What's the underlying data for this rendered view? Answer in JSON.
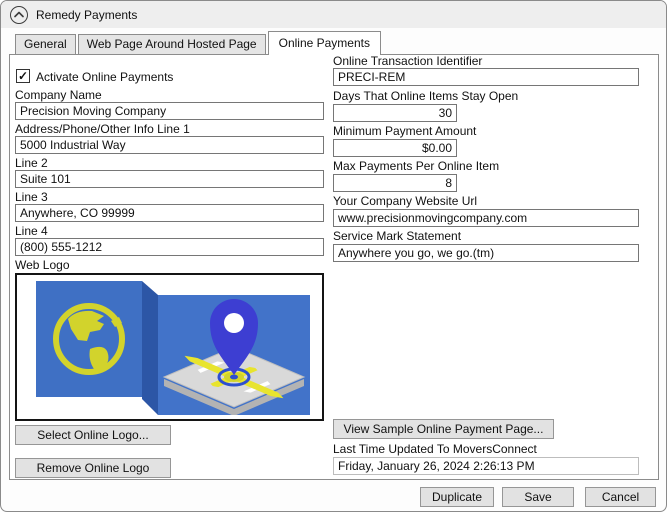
{
  "dialog": {
    "title": "Remedy Payments"
  },
  "tabs": [
    {
      "label": "General"
    },
    {
      "label": "Web Page Around Hosted Page"
    },
    {
      "label": "Online Payments"
    }
  ],
  "activate": {
    "label": "Activate Online Payments",
    "checked": true,
    "check_glyph": "✓"
  },
  "left": {
    "company_name": {
      "label": "Company Name",
      "value": "Precision Moving Company"
    },
    "address1": {
      "label": "Address/Phone/Other Info Line 1",
      "value": "5000 Industrial Way"
    },
    "line2": {
      "label": "Line 2",
      "value": "Suite 101"
    },
    "line3": {
      "label": "Line 3",
      "value": "Anywhere, CO 99999"
    },
    "line4": {
      "label": "Line 4",
      "value": "(800) 555-1212"
    },
    "web_logo_label": "Web Logo",
    "select_logo_button": "Select Online Logo...",
    "remove_logo_button": "Remove Online Logo"
  },
  "right": {
    "transaction_id": {
      "label": "Online Transaction Identifier",
      "value": "PRECI-REM"
    },
    "days_open": {
      "label": "Days That Online Items Stay Open",
      "value": "30"
    },
    "min_payment": {
      "label": "Minimum Payment Amount",
      "value": "$0.00"
    },
    "max_payments": {
      "label": "Max Payments Per Online Item",
      "value": "8"
    },
    "website_url": {
      "label": "Your Company Website Url",
      "value": "www.precisionmovingcompany.com"
    },
    "service_mark": {
      "label": "Service Mark Statement",
      "value": "Anywhere you go, we go.(tm)"
    },
    "view_sample_button": "View Sample Online Payment Page...",
    "last_updated": {
      "label": "Last Time Updated To MoversConnect",
      "value": "Friday, January 26, 2024 2:26:13 PM"
    }
  },
  "footer": {
    "duplicate_label": "Duplicate",
    "save_label": "Save",
    "cancel_label": "Cancel"
  },
  "colors": {
    "panel_blue": "#3f70c4",
    "panel_blue2": "#4273c9",
    "fold_blue": "#2c56a6",
    "globe_yellow": "#d2d32c",
    "pin_blue": "#3d3ed2",
    "road_yellow": "#e8e42e",
    "map_gray": "#d9d9d9"
  }
}
